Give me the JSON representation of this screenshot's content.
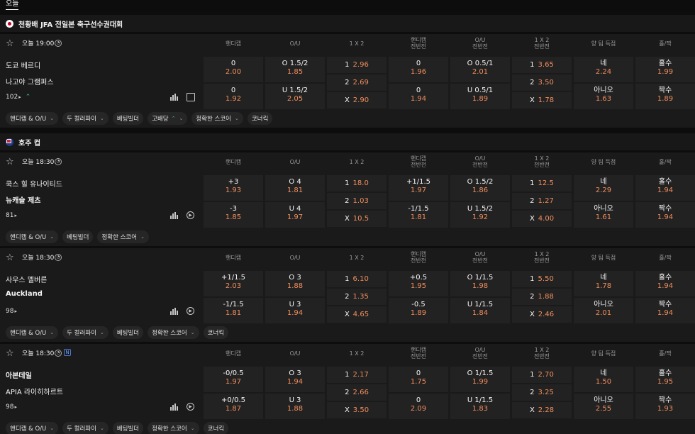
{
  "top_tab": "오늘",
  "leagues": [
    {
      "name": "천황배 JFA 전일본 축구선수권대회",
      "flag": "japan"
    },
    {
      "name": "호주 컵",
      "flag": "australia"
    }
  ],
  "columns": [
    {
      "key": "handicap",
      "label": "핸디캡"
    },
    {
      "key": "ou",
      "label": "O/U"
    },
    {
      "key": "x12",
      "label": "1 X 2"
    },
    {
      "key": "handicap_half",
      "label": "핸디캡\n전반전"
    },
    {
      "key": "ou_half",
      "label": "O/U\n전반전"
    },
    {
      "key": "x12_half",
      "label": "1 X 2\n전반전"
    },
    {
      "key": "btts",
      "label": "양 팀 득점"
    },
    {
      "key": "oddeven",
      "label": "홀/짝"
    }
  ],
  "matches": [
    {
      "time": "오늘 19:00",
      "badge": "",
      "home": "도쿄 베르디",
      "away": "나고야 그램퍼스",
      "home_bold": false,
      "away_bold": false,
      "count": "102",
      "handicap": [
        {
          "line": "0",
          "odds": "2.00"
        },
        {
          "line": "0",
          "odds": "1.92"
        }
      ],
      "ou": [
        {
          "line": "O 1.5/2",
          "odds": "1.85"
        },
        {
          "line": "U 1.5/2",
          "odds": "2.05"
        }
      ],
      "x12": [
        {
          "line": "1",
          "odds": "2.96"
        },
        {
          "line": "2",
          "odds": "2.69"
        },
        {
          "line": "X",
          "odds": "2.90"
        }
      ],
      "handicap_half": [
        {
          "line": "0",
          "odds": "1.96"
        },
        {
          "line": "0",
          "odds": "1.94"
        }
      ],
      "ou_half": [
        {
          "line": "O 0.5/1",
          "odds": "2.01"
        },
        {
          "line": "U 0.5/1",
          "odds": "1.89"
        }
      ],
      "x12_half": [
        {
          "line": "1",
          "odds": "3.65"
        },
        {
          "line": "2",
          "odds": "3.50"
        },
        {
          "line": "X",
          "odds": "1.78"
        }
      ],
      "btts": [
        {
          "line": "네",
          "odds": "2.24"
        },
        {
          "line": "아니오",
          "odds": "1.63"
        }
      ],
      "oddeven": [
        {
          "line": "홀수",
          "odds": "1.99"
        },
        {
          "line": "짝수",
          "odds": "1.89"
        }
      ],
      "chips": [
        "핸디캡 & O/U",
        "두 컬러파이",
        "베팅빌더",
        "고배당",
        "정확한 스코어",
        "코너킥"
      ]
    },
    {
      "time": "오늘 18:30",
      "badge": "",
      "home": "쿡스 힐 유나이티드",
      "away": "뉴캐슬 제츠",
      "home_bold": false,
      "away_bold": true,
      "count": "81",
      "handicap": [
        {
          "line": "+3",
          "odds": "1.93"
        },
        {
          "line": "-3",
          "odds": "1.85"
        }
      ],
      "ou": [
        {
          "line": "O 4",
          "odds": "1.81"
        },
        {
          "line": "U 4",
          "odds": "1.97"
        }
      ],
      "x12": [
        {
          "line": "1",
          "odds": "18.0"
        },
        {
          "line": "2",
          "odds": "1.03"
        },
        {
          "line": "X",
          "odds": "10.5"
        }
      ],
      "handicap_half": [
        {
          "line": "+1/1.5",
          "odds": "1.97"
        },
        {
          "line": "-1/1.5",
          "odds": "1.81"
        }
      ],
      "ou_half": [
        {
          "line": "O 1.5/2",
          "odds": "1.86"
        },
        {
          "line": "U 1.5/2",
          "odds": "1.92"
        }
      ],
      "x12_half": [
        {
          "line": "1",
          "odds": "12.5"
        },
        {
          "line": "2",
          "odds": "1.27"
        },
        {
          "line": "X",
          "odds": "4.00"
        }
      ],
      "btts": [
        {
          "line": "네",
          "odds": "2.29"
        },
        {
          "line": "아니오",
          "odds": "1.61"
        }
      ],
      "oddeven": [
        {
          "line": "홀수",
          "odds": "1.94"
        },
        {
          "line": "짝수",
          "odds": "1.94"
        }
      ],
      "chips": [
        "핸디캡 & O/U",
        "베팅빌더",
        "정확한 스코어"
      ]
    },
    {
      "time": "오늘 18:30",
      "badge": "",
      "home": "사우스 멜버른",
      "away": "Auckland",
      "home_bold": false,
      "away_bold": true,
      "count": "98",
      "handicap": [
        {
          "line": "+1/1.5",
          "odds": "2.03"
        },
        {
          "line": "-1/1.5",
          "odds": "1.81"
        }
      ],
      "ou": [
        {
          "line": "O 3",
          "odds": "1.88"
        },
        {
          "line": "U 3",
          "odds": "1.94"
        }
      ],
      "x12": [
        {
          "line": "1",
          "odds": "6.10"
        },
        {
          "line": "2",
          "odds": "1.35"
        },
        {
          "line": "X",
          "odds": "4.65"
        }
      ],
      "handicap_half": [
        {
          "line": "+0.5",
          "odds": "1.95"
        },
        {
          "line": "-0.5",
          "odds": "1.89"
        }
      ],
      "ou_half": [
        {
          "line": "O 1/1.5",
          "odds": "1.98"
        },
        {
          "line": "U 1/1.5",
          "odds": "1.84"
        }
      ],
      "x12_half": [
        {
          "line": "1",
          "odds": "5.50"
        },
        {
          "line": "2",
          "odds": "1.88"
        },
        {
          "line": "X",
          "odds": "2.46"
        }
      ],
      "btts": [
        {
          "line": "네",
          "odds": "1.78"
        },
        {
          "line": "아니오",
          "odds": "2.01"
        }
      ],
      "oddeven": [
        {
          "line": "홀수",
          "odds": "1.94"
        },
        {
          "line": "짝수",
          "odds": "1.94"
        }
      ],
      "chips": [
        "핸디캡 & O/U",
        "두 컬러파이",
        "베팅빌더",
        "정확한 스코어",
        "코너킥"
      ]
    },
    {
      "time": "오늘 18:30",
      "badge": "N",
      "home": "아본데일",
      "away": "APIA 라이히하르트",
      "home_bold": true,
      "away_bold": false,
      "count": "98",
      "handicap": [
        {
          "line": "-0/0.5",
          "odds": "1.97"
        },
        {
          "line": "+0/0.5",
          "odds": "1.87"
        }
      ],
      "ou": [
        {
          "line": "O 3",
          "odds": "1.94"
        },
        {
          "line": "U 3",
          "odds": "1.88"
        }
      ],
      "x12": [
        {
          "line": "1",
          "odds": "2.17"
        },
        {
          "line": "2",
          "odds": "2.66"
        },
        {
          "line": "X",
          "odds": "3.50"
        }
      ],
      "handicap_half": [
        {
          "line": "0",
          "odds": "1.75"
        },
        {
          "line": "0",
          "odds": "2.09"
        }
      ],
      "ou_half": [
        {
          "line": "O 1/1.5",
          "odds": "1.99"
        },
        {
          "line": "U 1/1.5",
          "odds": "1.83"
        }
      ],
      "x12_half": [
        {
          "line": "1",
          "odds": "2.70"
        },
        {
          "line": "2",
          "odds": "3.25"
        },
        {
          "line": "X",
          "odds": "2.28"
        }
      ],
      "btts": [
        {
          "line": "네",
          "odds": "1.50"
        },
        {
          "line": "아니오",
          "odds": "2.55"
        }
      ],
      "oddeven": [
        {
          "line": "홀수",
          "odds": "1.95"
        },
        {
          "line": "짝수",
          "odds": "1.93"
        }
      ],
      "chips": [
        "핸디캡 & O/U",
        "두 컬러파이",
        "베팅빌더",
        "정확한 스코어",
        "코너킥"
      ]
    }
  ],
  "colors": {
    "odds": "#f08d5c",
    "accent_green": "#3ec28f",
    "background": "#0d0d0d",
    "card": "#1a1a1a",
    "cell": "#222222"
  }
}
